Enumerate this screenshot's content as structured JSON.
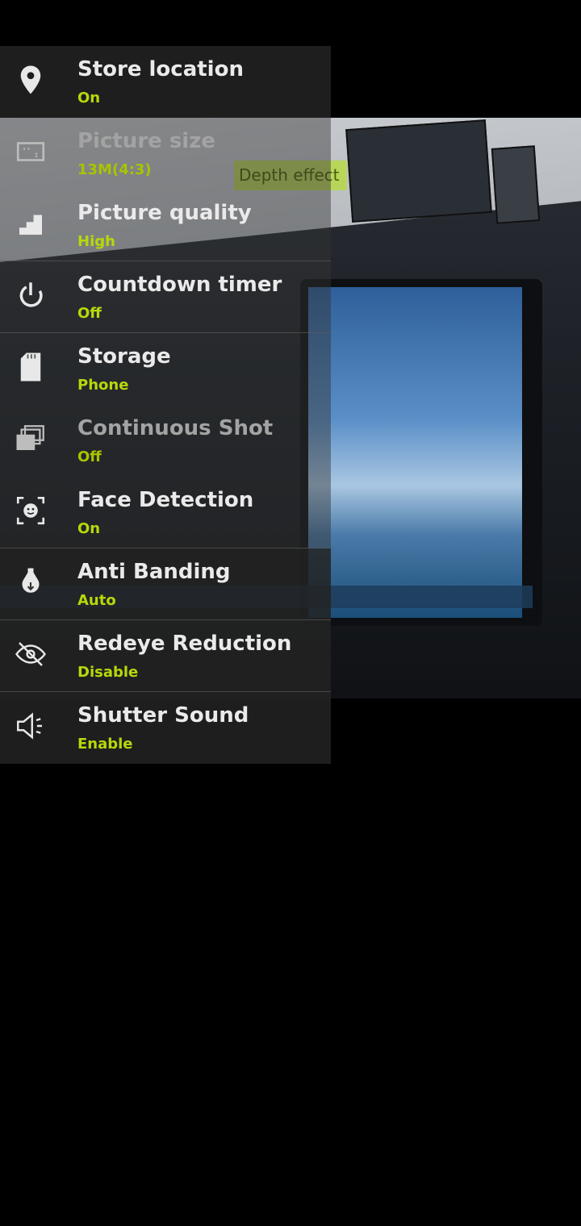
{
  "overlay": {
    "depth_effect_label": "Depth effect"
  },
  "settings": [
    {
      "name": "store-location",
      "label": "Store location",
      "value": "On",
      "icon": "location-pin-icon"
    },
    {
      "name": "picture-size",
      "label": "Picture size",
      "value": "13M(4:3)",
      "icon": "aspect-ratio-icon"
    },
    {
      "name": "picture-quality",
      "label": "Picture quality",
      "value": "High",
      "icon": "quality-steps-icon"
    },
    {
      "name": "countdown-timer",
      "label": "Countdown timer",
      "value": "Off",
      "icon": "timer-icon"
    },
    {
      "name": "storage",
      "label": "Storage",
      "value": "Phone",
      "icon": "sd-card-icon"
    },
    {
      "name": "continuous-shot",
      "label": "Continuous Shot",
      "value": "Off",
      "icon": "burst-icon"
    },
    {
      "name": "face-detection",
      "label": "Face Detection",
      "value": "On",
      "icon": "face-detect-icon"
    },
    {
      "name": "anti-banding",
      "label": "Anti Banding",
      "value": "Auto",
      "icon": "bulb-icon"
    },
    {
      "name": "redeye-reduction",
      "label": "Redeye Reduction",
      "value": "Disable",
      "icon": "eye-off-icon"
    },
    {
      "name": "shutter-sound",
      "label": "Shutter Sound",
      "value": "Enable",
      "icon": "speaker-icon"
    }
  ],
  "colors": {
    "accent": "#b7d80a",
    "label": "#eaeaea",
    "panel_bg": "#232323"
  }
}
